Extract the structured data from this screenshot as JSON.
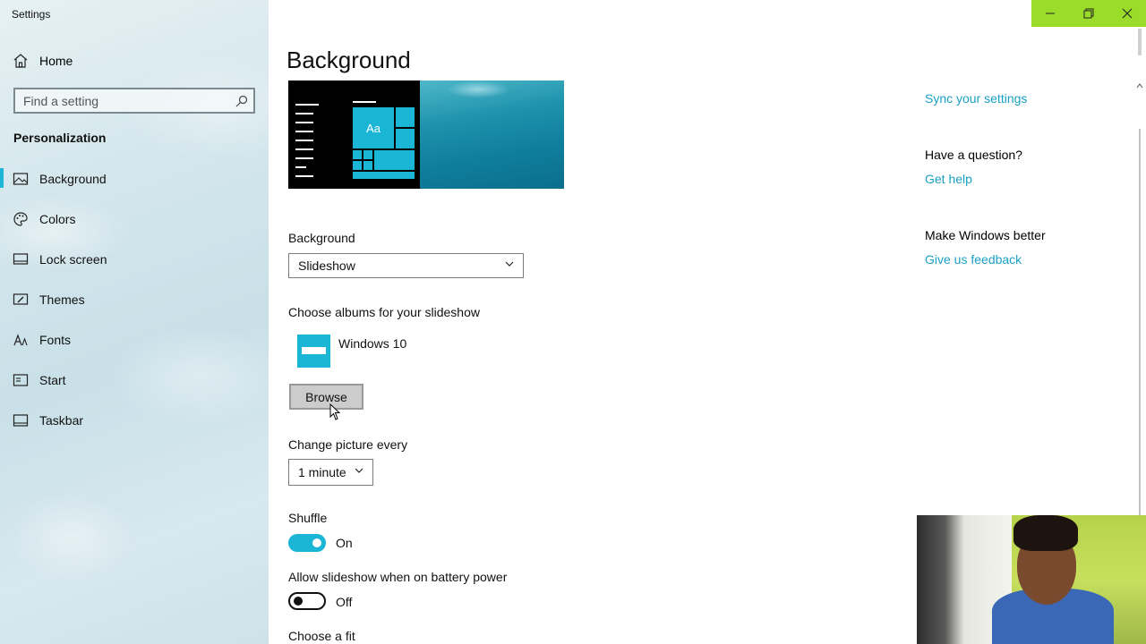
{
  "window": {
    "title": "Settings",
    "controls": {
      "minimize_icon": "minimize-icon",
      "restore_icon": "restore-icon",
      "close_icon": "close-icon"
    },
    "accent_bar_color": "#9bdc2a"
  },
  "sidebar": {
    "home_label": "Home",
    "search": {
      "placeholder": "Find a setting",
      "icon": "search-icon"
    },
    "section_title": "Personalization",
    "items": [
      {
        "label": "Background",
        "icon": "picture-icon",
        "active": true
      },
      {
        "label": "Colors",
        "icon": "palette-icon",
        "active": false
      },
      {
        "label": "Lock screen",
        "icon": "lock-screen-icon",
        "active": false
      },
      {
        "label": "Themes",
        "icon": "brush-icon",
        "active": false
      },
      {
        "label": "Fonts",
        "icon": "font-icon",
        "active": false
      },
      {
        "label": "Start",
        "icon": "start-icon",
        "active": false
      },
      {
        "label": "Taskbar",
        "icon": "taskbar-icon",
        "active": false
      }
    ]
  },
  "main": {
    "title": "Background",
    "preview": {
      "tile_text": "Aa"
    },
    "background_label": "Background",
    "background_value": "Slideshow",
    "albums_label": "Choose albums for your slideshow",
    "album_name": "Windows 10",
    "browse_label": "Browse",
    "change_label": "Change picture every",
    "change_value": "1 minute",
    "shuffle_label": "Shuffle",
    "shuffle_state": "On",
    "battery_label": "Allow slideshow when on battery power",
    "battery_state": "Off",
    "fit_label": "Choose a fit"
  },
  "right_panel": {
    "sync_link": "Sync your settings",
    "question_heading": "Have a question?",
    "help_link": "Get help",
    "better_heading": "Make Windows better",
    "feedback_link": "Give us feedback"
  },
  "colors": {
    "accent": "#1bb6d6",
    "link": "#1aa0c4"
  }
}
